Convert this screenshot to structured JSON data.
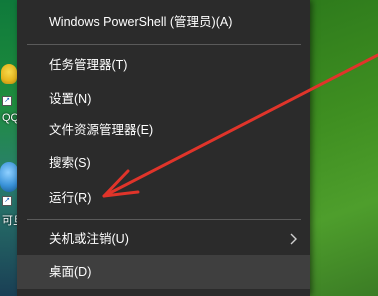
{
  "desktop": {
    "icons": [
      {
        "name": "qq-icon",
        "label": "QQ"
      },
      {
        "name": "app-icon",
        "label": "可旦"
      }
    ]
  },
  "menu": {
    "items": [
      {
        "label": "Windows PowerShell (管理员)(A)"
      },
      {
        "label": "任务管理器(T)"
      },
      {
        "label": "设置(N)"
      },
      {
        "label": "文件资源管理器(E)"
      },
      {
        "label": "搜索(S)"
      },
      {
        "label": "运行(R)"
      },
      {
        "label": "关机或注销(U)"
      },
      {
        "label": "桌面(D)"
      }
    ]
  },
  "colors": {
    "menu_bg": "#2b2b2b",
    "highlight_bg": "#3f3f3f",
    "annotation_arrow": "#e0342a"
  }
}
